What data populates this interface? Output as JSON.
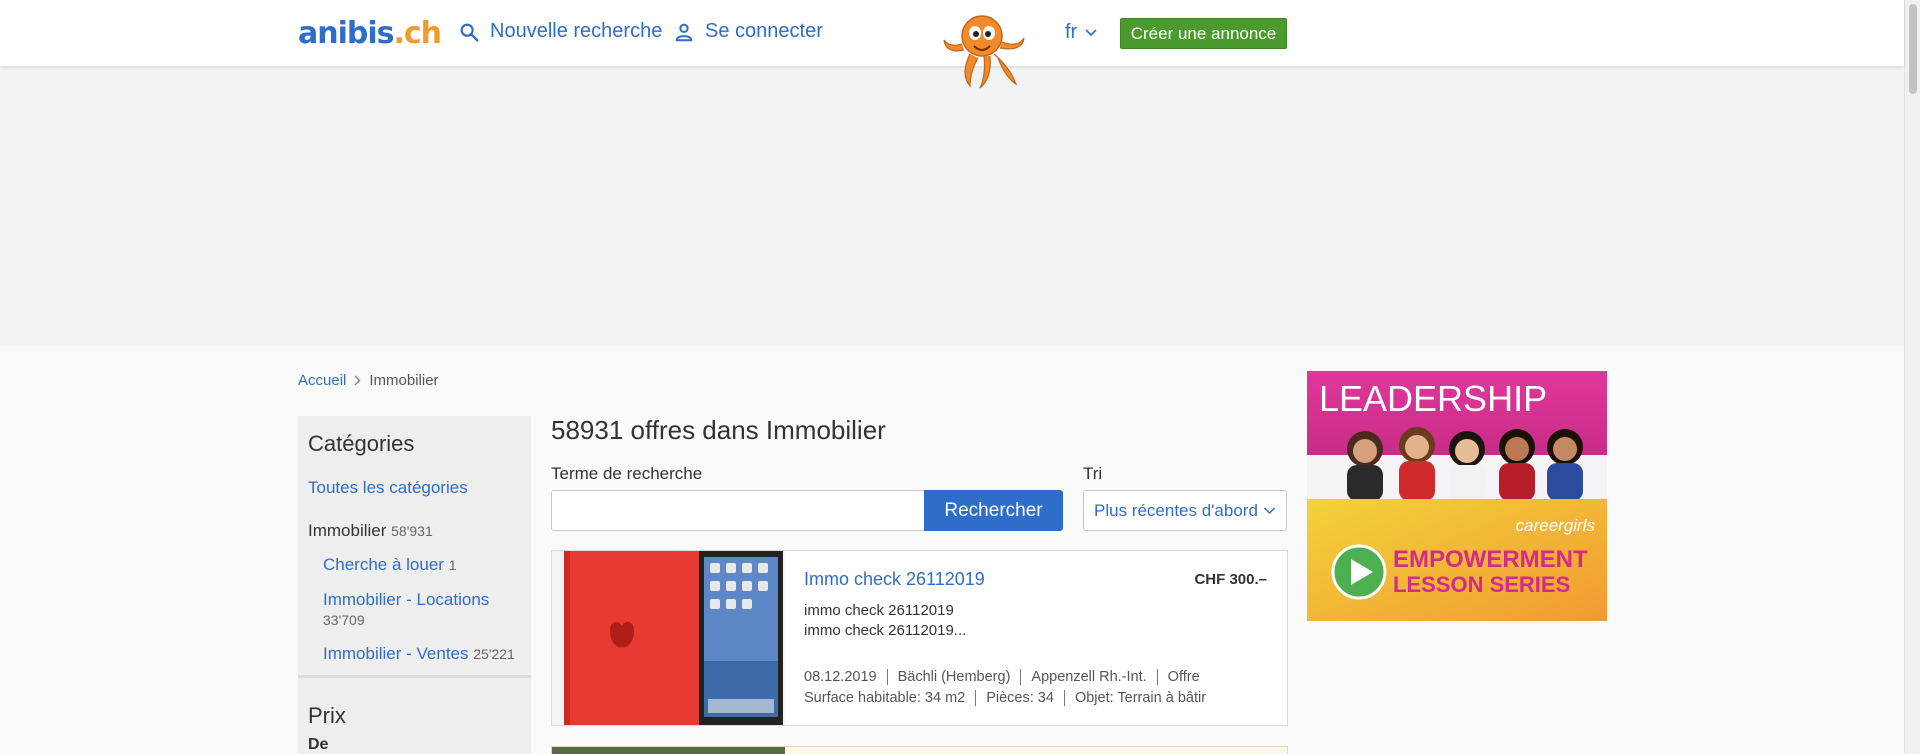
{
  "header": {
    "logo_main": "anibis",
    "logo_tld": ".ch",
    "new_search": "Nouvelle recherche",
    "login": "Se connecter",
    "language": "fr",
    "create_ad": "Créer une annonce"
  },
  "breadcrumb": {
    "home": "Accueil",
    "current": "Immobilier"
  },
  "sidebar": {
    "title": "Catégories",
    "all_categories": "Toutes les catégories",
    "category": {
      "label": "Immobilier",
      "count": "58'931"
    },
    "subcategories": [
      {
        "label": "Cherche à louer",
        "count": "1"
      },
      {
        "label": "Immobilier - Locations",
        "count": "33'709"
      },
      {
        "label": "Immobilier - Ventes",
        "count": "25'221"
      }
    ],
    "price_title": "Prix",
    "price_from": "De"
  },
  "main": {
    "title": "58931 offres dans Immobilier",
    "search_label": "Terme de recherche",
    "search_value": "",
    "search_button": "Rechercher",
    "sort_label": "Tri",
    "sort_value": "Plus récentes d'abord"
  },
  "listings": [
    {
      "title": "Immo check 26112019",
      "price": "CHF 300.–",
      "desc_line1": "immo check 26112019",
      "desc_line2": "immo check 26112019...",
      "date": "08.12.2019",
      "place": "Bächli (Hemberg)",
      "region": "Appenzell Rh.-Int.",
      "type": "Offre",
      "surface": "Surface habitable: 34 m2",
      "rooms": "Pièces: 34",
      "object": "Objet: Terrain à bâtir"
    }
  ],
  "right_ad": {
    "headline": "LEADERSHIP",
    "brand": "careergirls",
    "line1": "EMPOWERMENT",
    "line2": "LESSON SERIES"
  },
  "colors": {
    "brand_blue": "#2e6dc9",
    "brand_orange": "#f39b2a",
    "create_green": "#4a9a2e"
  }
}
